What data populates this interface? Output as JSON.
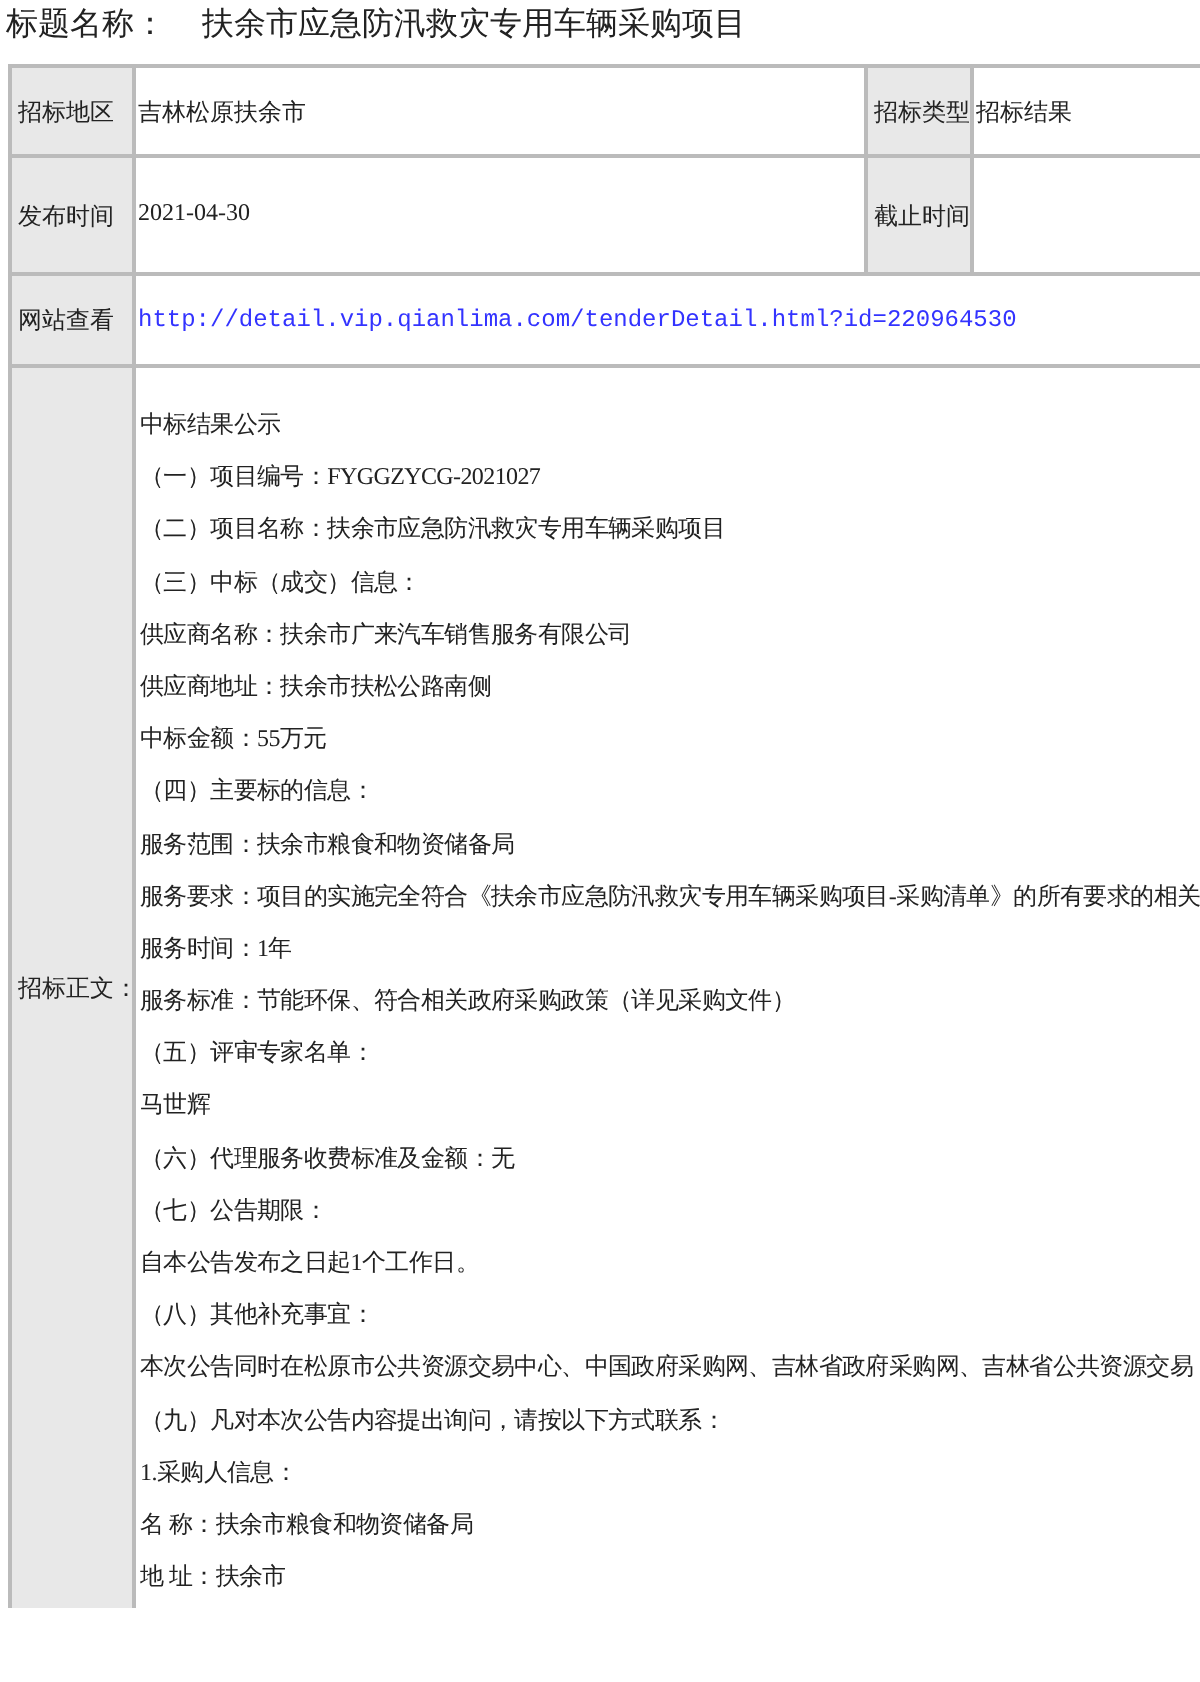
{
  "heading": {
    "label": "标题名称：",
    "title": "扶余市应急防汛救灾专用车辆采购项目"
  },
  "table": {
    "rows": [
      {
        "cells": [
          {
            "kind": "label",
            "text": "招标地区"
          },
          {
            "kind": "value",
            "text": "吉林松原扶余市"
          },
          {
            "kind": "label",
            "text": "招标类型"
          },
          {
            "kind": "value",
            "text": "招标结果"
          }
        ]
      },
      {
        "cells": [
          {
            "kind": "label",
            "text": "发布时间"
          },
          {
            "kind": "value",
            "text": "2021-04-30"
          },
          {
            "kind": "label",
            "text": "截止时间"
          },
          {
            "kind": "value",
            "text": ""
          }
        ]
      },
      {
        "cells": [
          {
            "kind": "label",
            "text": "网站查看"
          },
          {
            "kind": "link",
            "text": "http://detail.vip.qianlima.com/tenderDetail.html?id=220964530"
          }
        ]
      }
    ],
    "body": {
      "label": "招标正文：",
      "lines": [
        "中标结果公示",
        "（一）项目编号：FYGGZYCG-2021027",
        "（二）项目名称：扶余市应急防汛救灾专用车辆采购项目",
        "（三）中标（成交）信息：",
        "供应商名称：扶余市广来汽车销售服务有限公司",
        "供应商地址：扶余市扶松公路南侧",
        "中标金额：55万元",
        "（四）主要标的信息：",
        "服务范围：扶余市粮食和物资储备局",
        "服务要求：项目的实施完全符合《扶余市应急防汛救灾专用车辆采购项目-采购清单》的所有要求的相关",
        "服务时间：1年",
        "服务标准：节能环保、符合相关政府采购政策（详见采购文件）",
        "（五）评审专家名单：",
        "马世辉",
        "（六）代理服务收费标准及金额：无",
        "（七）公告期限：",
        "自本公告发布之日起1个工作日。",
        "（八）其他补充事宜：",
        "本次公告同时在松原市公共资源交易中心、中国政府采购网、吉林省政府采购网、吉林省公共资源交易",
        "（九）凡对本次公告内容提出询问，请按以下方式联系：",
        "1.采购人信息：",
        "名 称：扶余市粮食和物资储备局",
        "地 址：扶余市"
      ]
    }
  }
}
